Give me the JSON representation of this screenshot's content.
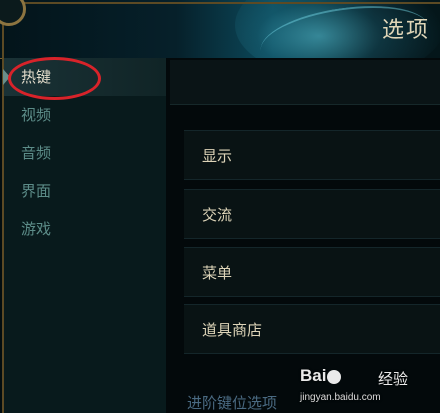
{
  "window": {
    "title": "选项"
  },
  "sidebar": {
    "items": [
      {
        "label": "热键",
        "active": true
      },
      {
        "label": "视频",
        "active": false
      },
      {
        "label": "音频",
        "active": false
      },
      {
        "label": "界面",
        "active": false
      },
      {
        "label": "游戏",
        "active": false
      }
    ]
  },
  "main": {
    "categories": [
      {
        "label": "显示"
      },
      {
        "label": "交流"
      },
      {
        "label": "菜单"
      },
      {
        "label": "道具商店"
      }
    ],
    "advanced_label": "进阶键位选项"
  },
  "watermark": {
    "logo_text": "Bai",
    "logo_suffix": "经验",
    "url": "jingyan.baidu.com"
  },
  "colors": {
    "annotation": "#d8232a",
    "gold_border": "#786030",
    "active_text": "#e2dccb",
    "inactive_text": "#5c8c88"
  }
}
